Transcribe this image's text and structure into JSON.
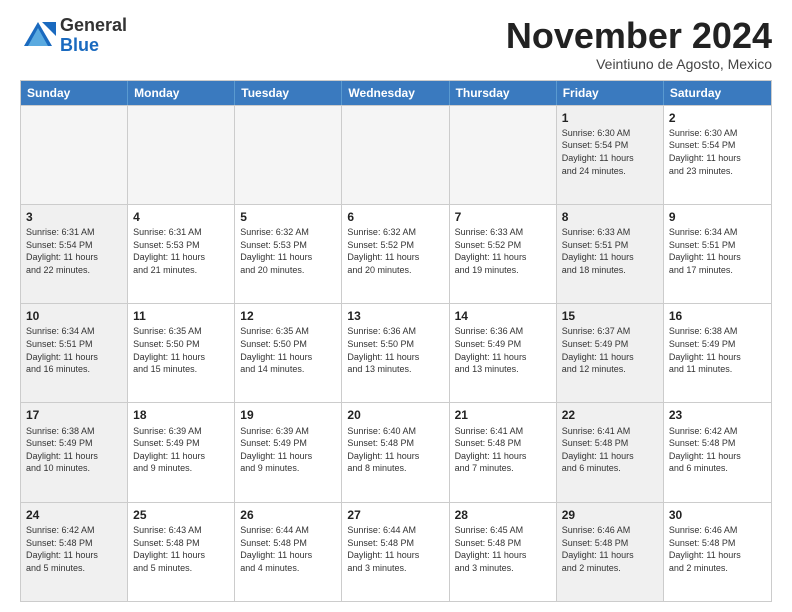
{
  "logo": {
    "general": "General",
    "blue": "Blue"
  },
  "header": {
    "month": "November 2024",
    "location": "Veintiuno de Agosto, Mexico"
  },
  "weekdays": [
    "Sunday",
    "Monday",
    "Tuesday",
    "Wednesday",
    "Thursday",
    "Friday",
    "Saturday"
  ],
  "rows": [
    [
      {
        "day": "",
        "info": "",
        "empty": true
      },
      {
        "day": "",
        "info": "",
        "empty": true
      },
      {
        "day": "",
        "info": "",
        "empty": true
      },
      {
        "day": "",
        "info": "",
        "empty": true
      },
      {
        "day": "",
        "info": "",
        "empty": true
      },
      {
        "day": "1",
        "info": "Sunrise: 6:30 AM\nSunset: 5:54 PM\nDaylight: 11 hours\nand 24 minutes.",
        "shaded": true
      },
      {
        "day": "2",
        "info": "Sunrise: 6:30 AM\nSunset: 5:54 PM\nDaylight: 11 hours\nand 23 minutes.",
        "shaded": false
      }
    ],
    [
      {
        "day": "3",
        "info": "Sunrise: 6:31 AM\nSunset: 5:54 PM\nDaylight: 11 hours\nand 22 minutes.",
        "shaded": true
      },
      {
        "day": "4",
        "info": "Sunrise: 6:31 AM\nSunset: 5:53 PM\nDaylight: 11 hours\nand 21 minutes.",
        "shaded": false
      },
      {
        "day": "5",
        "info": "Sunrise: 6:32 AM\nSunset: 5:53 PM\nDaylight: 11 hours\nand 20 minutes.",
        "shaded": false
      },
      {
        "day": "6",
        "info": "Sunrise: 6:32 AM\nSunset: 5:52 PM\nDaylight: 11 hours\nand 20 minutes.",
        "shaded": false
      },
      {
        "day": "7",
        "info": "Sunrise: 6:33 AM\nSunset: 5:52 PM\nDaylight: 11 hours\nand 19 minutes.",
        "shaded": false
      },
      {
        "day": "8",
        "info": "Sunrise: 6:33 AM\nSunset: 5:51 PM\nDaylight: 11 hours\nand 18 minutes.",
        "shaded": true
      },
      {
        "day": "9",
        "info": "Sunrise: 6:34 AM\nSunset: 5:51 PM\nDaylight: 11 hours\nand 17 minutes.",
        "shaded": false
      }
    ],
    [
      {
        "day": "10",
        "info": "Sunrise: 6:34 AM\nSunset: 5:51 PM\nDaylight: 11 hours\nand 16 minutes.",
        "shaded": true
      },
      {
        "day": "11",
        "info": "Sunrise: 6:35 AM\nSunset: 5:50 PM\nDaylight: 11 hours\nand 15 minutes.",
        "shaded": false
      },
      {
        "day": "12",
        "info": "Sunrise: 6:35 AM\nSunset: 5:50 PM\nDaylight: 11 hours\nand 14 minutes.",
        "shaded": false
      },
      {
        "day": "13",
        "info": "Sunrise: 6:36 AM\nSunset: 5:50 PM\nDaylight: 11 hours\nand 13 minutes.",
        "shaded": false
      },
      {
        "day": "14",
        "info": "Sunrise: 6:36 AM\nSunset: 5:49 PM\nDaylight: 11 hours\nand 13 minutes.",
        "shaded": false
      },
      {
        "day": "15",
        "info": "Sunrise: 6:37 AM\nSunset: 5:49 PM\nDaylight: 11 hours\nand 12 minutes.",
        "shaded": true
      },
      {
        "day": "16",
        "info": "Sunrise: 6:38 AM\nSunset: 5:49 PM\nDaylight: 11 hours\nand 11 minutes.",
        "shaded": false
      }
    ],
    [
      {
        "day": "17",
        "info": "Sunrise: 6:38 AM\nSunset: 5:49 PM\nDaylight: 11 hours\nand 10 minutes.",
        "shaded": true
      },
      {
        "day": "18",
        "info": "Sunrise: 6:39 AM\nSunset: 5:49 PM\nDaylight: 11 hours\nand 9 minutes.",
        "shaded": false
      },
      {
        "day": "19",
        "info": "Sunrise: 6:39 AM\nSunset: 5:49 PM\nDaylight: 11 hours\nand 9 minutes.",
        "shaded": false
      },
      {
        "day": "20",
        "info": "Sunrise: 6:40 AM\nSunset: 5:48 PM\nDaylight: 11 hours\nand 8 minutes.",
        "shaded": false
      },
      {
        "day": "21",
        "info": "Sunrise: 6:41 AM\nSunset: 5:48 PM\nDaylight: 11 hours\nand 7 minutes.",
        "shaded": false
      },
      {
        "day": "22",
        "info": "Sunrise: 6:41 AM\nSunset: 5:48 PM\nDaylight: 11 hours\nand 6 minutes.",
        "shaded": true
      },
      {
        "day": "23",
        "info": "Sunrise: 6:42 AM\nSunset: 5:48 PM\nDaylight: 11 hours\nand 6 minutes.",
        "shaded": false
      }
    ],
    [
      {
        "day": "24",
        "info": "Sunrise: 6:42 AM\nSunset: 5:48 PM\nDaylight: 11 hours\nand 5 minutes.",
        "shaded": true
      },
      {
        "day": "25",
        "info": "Sunrise: 6:43 AM\nSunset: 5:48 PM\nDaylight: 11 hours\nand 5 minutes.",
        "shaded": false
      },
      {
        "day": "26",
        "info": "Sunrise: 6:44 AM\nSunset: 5:48 PM\nDaylight: 11 hours\nand 4 minutes.",
        "shaded": false
      },
      {
        "day": "27",
        "info": "Sunrise: 6:44 AM\nSunset: 5:48 PM\nDaylight: 11 hours\nand 3 minutes.",
        "shaded": false
      },
      {
        "day": "28",
        "info": "Sunrise: 6:45 AM\nSunset: 5:48 PM\nDaylight: 11 hours\nand 3 minutes.",
        "shaded": false
      },
      {
        "day": "29",
        "info": "Sunrise: 6:46 AM\nSunset: 5:48 PM\nDaylight: 11 hours\nand 2 minutes.",
        "shaded": true
      },
      {
        "day": "30",
        "info": "Sunrise: 6:46 AM\nSunset: 5:48 PM\nDaylight: 11 hours\nand 2 minutes.",
        "shaded": false
      }
    ]
  ]
}
